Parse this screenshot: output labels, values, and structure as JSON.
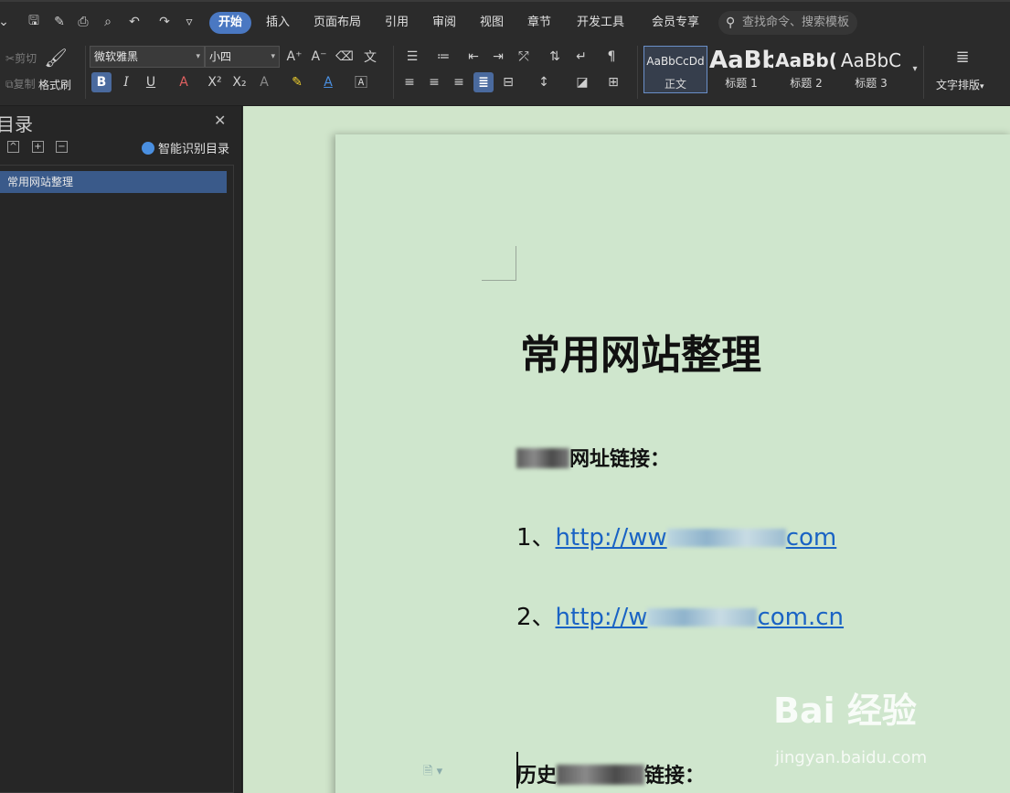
{
  "quick_access": [
    "save-icon",
    "format-painter-icon",
    "print-icon",
    "print-preview-icon",
    "undo-icon",
    "redo-icon",
    "more-icon"
  ],
  "tabs": [
    {
      "label": "开始",
      "active": true
    },
    {
      "label": "插入"
    },
    {
      "label": "页面布局"
    },
    {
      "label": "引用"
    },
    {
      "label": "审阅"
    },
    {
      "label": "视图"
    },
    {
      "label": "章节"
    },
    {
      "label": "开发工具"
    },
    {
      "label": "会员专享"
    }
  ],
  "search": {
    "placeholder": "查找命令、搜索模板"
  },
  "ribbon": {
    "cut_label": "剪切",
    "copy_label": "复制",
    "format_painter_label": "格式刷",
    "font_name": "微软雅黑",
    "font_size": "小四",
    "styles": [
      {
        "sample": "AaBbCcDd",
        "name": "正文"
      },
      {
        "sample": "AaBb",
        "name": "标题 1"
      },
      {
        "sample": "AaBb(",
        "name": "标题 2"
      },
      {
        "sample": "AaBbC",
        "name": "标题 3"
      }
    ],
    "text_layout_label": "文字排版"
  },
  "sidebar": {
    "title": "目录",
    "smart_toc_label": "智能识别目录",
    "items": [
      "常用网站整理"
    ]
  },
  "document": {
    "title": "常用网站整理",
    "section1_heading": "网址链接：",
    "links": [
      {
        "num": "1、",
        "prefix": "http://ww",
        "suffix": "com"
      },
      {
        "num": "2、",
        "prefix": "http://w",
        "suffix": "com.cn"
      }
    ],
    "section2_heading_start": "历史",
    "section2_heading_end": "链接："
  },
  "watermark": {
    "brand": "Bai 经验",
    "url": "jingyan.baidu.com"
  },
  "colors": {
    "accent": "#4a78c2",
    "page": "#cfe6cd",
    "link": "#1a63c4"
  }
}
